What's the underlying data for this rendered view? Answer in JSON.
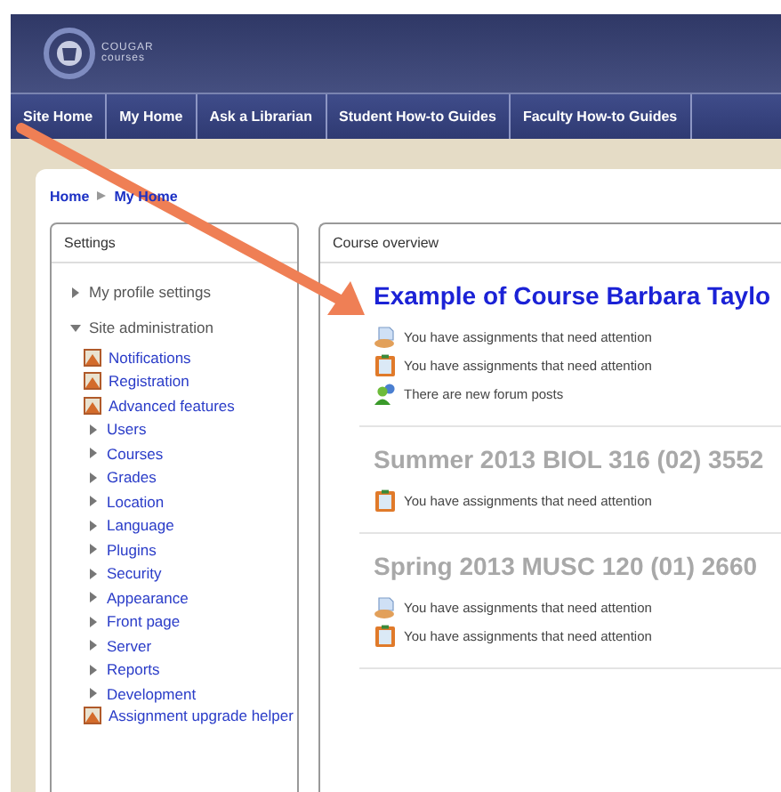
{
  "header": {
    "logo_line1": "COUGAR",
    "logo_line2": "courses"
  },
  "nav": [
    "Site Home",
    "My Home",
    "Ask a Librarian",
    "Student How-to Guides",
    "Faculty How-to Guides"
  ],
  "breadcrumb": [
    "Home",
    "My Home"
  ],
  "settings": {
    "title": "Settings",
    "items": [
      {
        "label": "My profile settings",
        "expanded": false
      },
      {
        "label": "Site administration",
        "expanded": true,
        "children": [
          {
            "label": "Notifications",
            "kind": "page"
          },
          {
            "label": "Registration",
            "kind": "page"
          },
          {
            "label": "Advanced features",
            "kind": "page"
          },
          {
            "label": "Users",
            "kind": "category"
          },
          {
            "label": "Courses",
            "kind": "category"
          },
          {
            "label": "Grades",
            "kind": "category"
          },
          {
            "label": "Location",
            "kind": "category"
          },
          {
            "label": "Language",
            "kind": "category"
          },
          {
            "label": "Plugins",
            "kind": "category"
          },
          {
            "label": "Security",
            "kind": "category"
          },
          {
            "label": "Appearance",
            "kind": "category"
          },
          {
            "label": "Front page",
            "kind": "category"
          },
          {
            "label": "Server",
            "kind": "category"
          },
          {
            "label": "Reports",
            "kind": "category"
          },
          {
            "label": "Development",
            "kind": "category"
          },
          {
            "label": "Assignment upgrade helper",
            "kind": "page"
          }
        ]
      }
    ]
  },
  "course_overview": {
    "title": "Course overview",
    "courses": [
      {
        "title": "Example of Course Barbara Taylo",
        "hidden": false,
        "notices": [
          {
            "kind": "document",
            "text": "You have assignments that need attention"
          },
          {
            "kind": "clipboard",
            "text": "You have assignments that need attention"
          },
          {
            "kind": "forum",
            "text": "There are new forum posts"
          }
        ]
      },
      {
        "title": "Summer 2013 BIOL 316 (02) 3552",
        "hidden": true,
        "notices": [
          {
            "kind": "clipboard",
            "text": "You have assignments that need attention"
          }
        ]
      },
      {
        "title": "Spring 2013 MUSC 120 (01) 2660",
        "hidden": true,
        "notices": [
          {
            "kind": "document",
            "text": "You have assignments that need attention"
          },
          {
            "kind": "clipboard",
            "text": "You have assignments that need attention"
          }
        ]
      }
    ]
  }
}
